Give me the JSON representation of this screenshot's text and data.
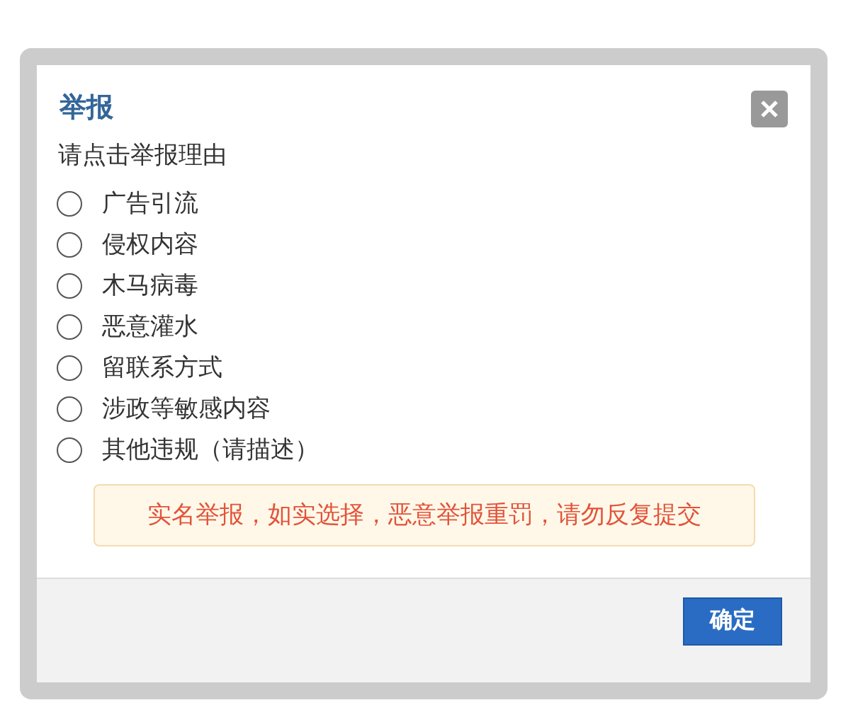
{
  "dialog": {
    "title": "举报",
    "prompt": "请点击举报理由",
    "options": [
      {
        "label": "广告引流",
        "selected": false
      },
      {
        "label": "侵权内容",
        "selected": false
      },
      {
        "label": "木马病毒",
        "selected": false
      },
      {
        "label": "恶意灌水",
        "selected": false
      },
      {
        "label": "留联系方式",
        "selected": false
      },
      {
        "label": "涉政等敏感内容",
        "selected": false
      },
      {
        "label": "其他违规（请描述）",
        "selected": false
      }
    ],
    "notice": "实名举报，如实选择，恶意举报重罚，请勿反复提交",
    "confirm_button": "确定"
  }
}
